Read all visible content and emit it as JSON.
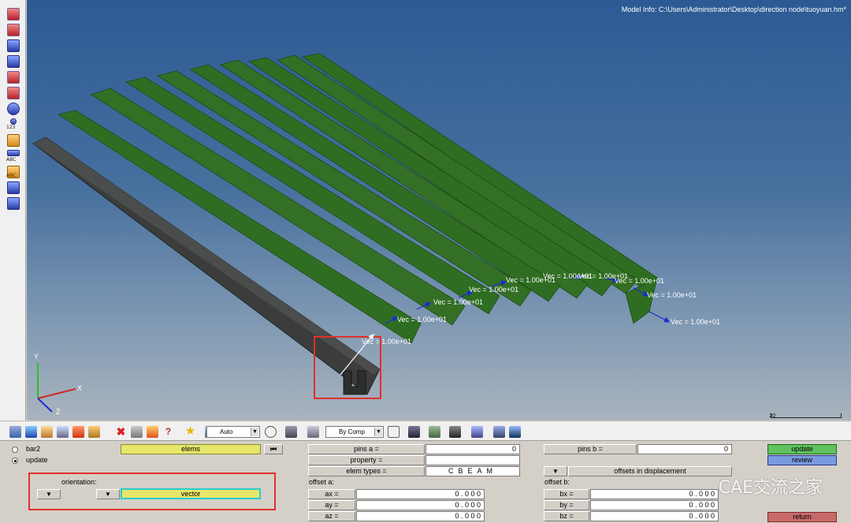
{
  "viewport": {
    "model_info": "Model Info: C:\\Users\\Administrator\\Desktop\\direction node\\tuoyuan.hm*",
    "vector_labels": [
      "Vec = 1.00e+01",
      "Vec = 1.00e+01",
      "Vec = 1.00e+01",
      "Vec = 1.00e+01",
      "Vec = 1.00e+01",
      "Vec = 1.00e+01",
      "Vec = 1.00e+01",
      "Vec = 1.00e+01",
      "Vec = 1.00e+01",
      "Vec = 1.00e+01"
    ],
    "triad": {
      "x": "X",
      "y": "Y",
      "z": "Z"
    },
    "scale_label": "20"
  },
  "left_toolbar": {
    "labels": [
      "123",
      "ABC",
      "ABC"
    ]
  },
  "bottom_toolbar": {
    "auto_select": "Auto",
    "bycomp_select": "By Comp"
  },
  "panel": {
    "radio_bar2": "bar2",
    "radio_update": "update",
    "elems_button": "elems",
    "orientation_label": "orientation:",
    "dropdown_glyph": "▼",
    "vector_button": "vector",
    "pins_a_label": "pins  a =",
    "pins_a_value": "0",
    "property_label": "property =",
    "elem_types_label": "elem types =",
    "elem_types_value": "CBEAM",
    "offset_a_label": "offset a:",
    "ax_label": "ax =",
    "ay_label": "ay =",
    "az_label": "az =",
    "ax_value": "0 . 0 0 0",
    "ay_value": "0 . 0 0 0",
    "az_value": "0 . 0 0 0",
    "pins_b_label": "pins b =",
    "pins_b_value": "0",
    "offsets_label": "offsets in displacement",
    "offset_b_label": "offset b:",
    "bx_label": "bx =",
    "by_label": "by =",
    "bz_label": "bz =",
    "bx_value": "0 . 0 0 0",
    "by_value": "0 . 0 0 0",
    "bz_value": "0 . 0 0 0",
    "update_button": "update",
    "review_button": "review",
    "return_button": "return",
    "watermark": "CAE交流之家"
  },
  "colors": {
    "beam_green": "#2f6e22",
    "beam_gray": "#3a3d3c",
    "highlight_red": "#e0302a",
    "yellow_button": "#e6e66a",
    "green_button": "#5fc25f",
    "blue_button": "#7a9ae0",
    "red_button": "#c86a6a"
  }
}
